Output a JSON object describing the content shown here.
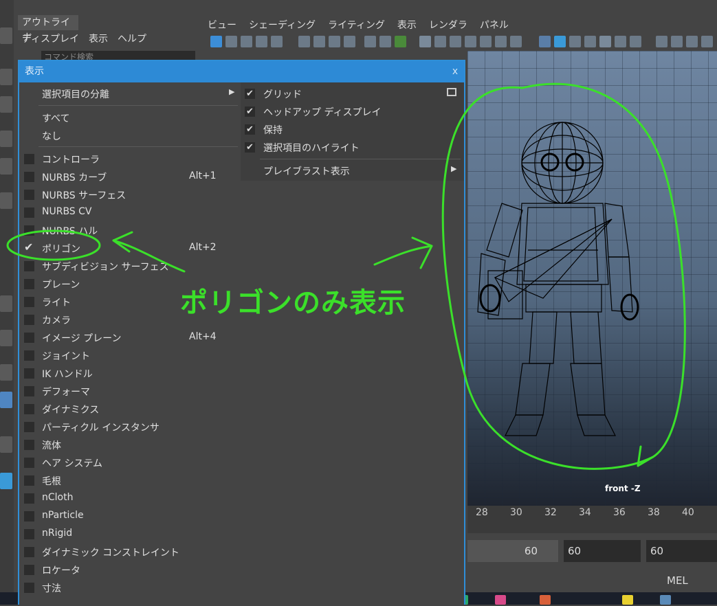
{
  "outliner": {
    "tab": "アウトライナ",
    "menu": [
      "ディスプレイ",
      "表示",
      "ヘルプ"
    ],
    "search_placeholder": "コマンド検索"
  },
  "viewport": {
    "menu": [
      "ビュー",
      "シェーディング",
      "ライティング",
      "表示",
      "レンダラ",
      "パネル"
    ],
    "camera_label": "front -Z"
  },
  "timeline": {
    "ticks": [
      "28",
      "30",
      "32",
      "34",
      "36",
      "38",
      "40"
    ]
  },
  "range": {
    "field_a": "60",
    "field_b": "60",
    "field_c": "60"
  },
  "command_line": {
    "mel_label": "MEL"
  },
  "display_window": {
    "title": "表示",
    "close": "x",
    "isolate_select": "選択項目の分離",
    "all": "すべて",
    "none": "なし",
    "items": [
      {
        "label": "コントローラ",
        "shortcut": "",
        "checked": false
      },
      {
        "label": "NURBS カーブ",
        "shortcut": "Alt+1",
        "checked": false
      },
      {
        "label": "NURBS サーフェス",
        "shortcut": "",
        "checked": false
      },
      {
        "label": "NURBS CV",
        "shortcut": "",
        "checked": false
      },
      {
        "label": "NURBS ハル",
        "shortcut": "",
        "checked": false
      },
      {
        "label": "ポリゴン",
        "shortcut": "Alt+2",
        "checked": true
      },
      {
        "label": "サブディビジョン サーフェス",
        "shortcut": "",
        "checked": false
      },
      {
        "label": "プレーン",
        "shortcut": "",
        "checked": false
      },
      {
        "label": "ライト",
        "shortcut": "",
        "checked": false
      },
      {
        "label": "カメラ",
        "shortcut": "",
        "checked": false
      },
      {
        "label": "イメージ プレーン",
        "shortcut": "Alt+4",
        "checked": false
      },
      {
        "label": "ジョイント",
        "shortcut": "",
        "checked": false
      },
      {
        "label": "IK ハンドル",
        "shortcut": "",
        "checked": false
      },
      {
        "label": "デフォーマ",
        "shortcut": "",
        "checked": false
      },
      {
        "label": "ダイナミクス",
        "shortcut": "",
        "checked": false
      },
      {
        "label": "パーティクル インスタンサ",
        "shortcut": "",
        "checked": false
      },
      {
        "label": "流体",
        "shortcut": "",
        "checked": false
      },
      {
        "label": "ヘア システム",
        "shortcut": "",
        "checked": false
      },
      {
        "label": "毛根",
        "shortcut": "",
        "checked": false
      },
      {
        "label": "nCloth",
        "shortcut": "",
        "checked": false
      },
      {
        "label": "nParticle",
        "shortcut": "",
        "checked": false
      },
      {
        "label": "nRigid",
        "shortcut": "",
        "checked": false
      },
      {
        "label": "ダイナミック コンストレイント",
        "shortcut": "",
        "checked": false
      },
      {
        "label": "ロケータ",
        "shortcut": "",
        "checked": false
      },
      {
        "label": "寸法",
        "shortcut": "",
        "checked": false
      }
    ],
    "submenu": [
      {
        "label": "グリッド",
        "checked": true
      },
      {
        "label": "ヘッドアップ ディスプレイ",
        "checked": true
      },
      {
        "label": "保持",
        "checked": true
      },
      {
        "label": "選択項目のハイライト",
        "checked": true
      }
    ],
    "playblast": "プレイブラスト表示"
  },
  "annotation": {
    "text": "ポリゴンのみ表示",
    "color": "#3be02a"
  },
  "colors": {
    "title_bar": "#2d8ad6",
    "panel": "#444444"
  }
}
